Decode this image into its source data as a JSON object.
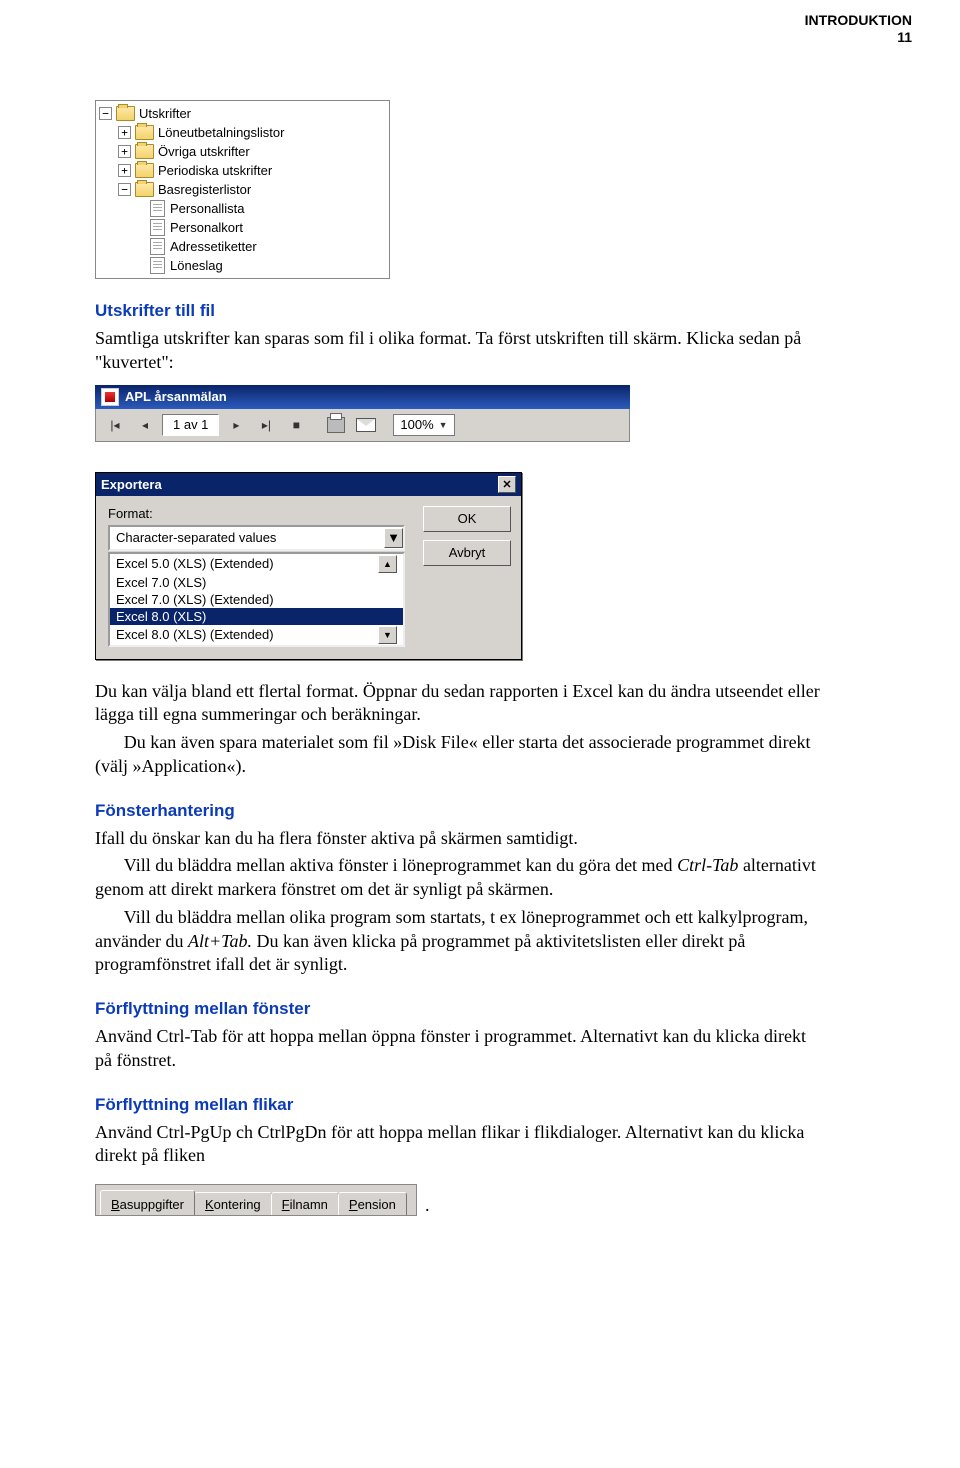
{
  "header": {
    "title": "INTRODUKTION",
    "page": "11"
  },
  "tree": {
    "root": "Utskrifter",
    "children": [
      {
        "label": "Löneutbetalningslistor"
      },
      {
        "label": "Övriga utskrifter"
      },
      {
        "label": "Periodiska utskrifter"
      },
      {
        "label": "Basregisterlistor",
        "children": [
          {
            "label": "Personallista"
          },
          {
            "label": "Personalkort"
          },
          {
            "label": "Adressetiketter"
          },
          {
            "label": "Löneslag"
          }
        ]
      }
    ]
  },
  "section1": {
    "heading": "Utskrifter till fil",
    "p1": "Samtliga utskrifter kan sparas som fil i olika format. Ta först utskriften till skärm. Klicka sedan på \"kuvertet\":"
  },
  "viewer": {
    "title": "APL årsanmälan",
    "page_indicator": "1 av 1",
    "zoom": "100%"
  },
  "dialog": {
    "title": "Exportera",
    "format_label": "Format:",
    "selected": "Character-separated values",
    "options": [
      "Excel 5.0 (XLS) (Extended)",
      "Excel 7.0 (XLS)",
      "Excel 7.0 (XLS) (Extended)",
      "Excel 8.0 (XLS)",
      "Excel 8.0 (XLS) (Extended)"
    ],
    "ok": "OK",
    "cancel": "Avbryt"
  },
  "body2": {
    "p1": "Du kan välja bland ett flertal format. Öppnar du sedan rapporten i Excel kan du ändra utseendet eller lägga till egna summeringar och beräkningar.",
    "p2": "Du kan även spara materialet som fil »Disk File« eller starta det associerade programmet direkt (välj »Application«)."
  },
  "section2": {
    "heading": "Fönsterhantering",
    "p1": "Ifall du önskar kan du ha flera fönster aktiva på skärmen samtidigt.",
    "p2a": "Vill du bläddra mellan aktiva fönster i löneprogrammet kan du göra det med ",
    "p2_em": "Ctrl-Tab",
    "p2b": " alternativt genom att direkt markera fönstret om det är synligt på skärmen.",
    "p3a": "Vill du bläddra mellan olika program som startats, t ex löneprogrammet och ett kalkylprogram, använder du ",
    "p3_em": "Alt+Tab.",
    "p3b": " Du kan även klicka på programmet på aktivitetslisten eller direkt på programfönstret ifall det är synligt."
  },
  "section3": {
    "heading": "Förflyttning mellan fönster",
    "p1": "Använd Ctrl-Tab för att hoppa mellan öppna fönster i programmet. Alternativt kan du klicka direkt på fönstret."
  },
  "section4": {
    "heading": "Förflyttning mellan flikar",
    "p1": "Använd Ctrl-PgUp ch CtrlPgDn för att hoppa mellan flikar i flikdialoger. Alternativt kan du klicka direkt på fliken"
  },
  "tabs": [
    "Basuppgifter",
    "Kontering",
    "Filnamn",
    "Pension"
  ],
  "trailing_dot": "."
}
